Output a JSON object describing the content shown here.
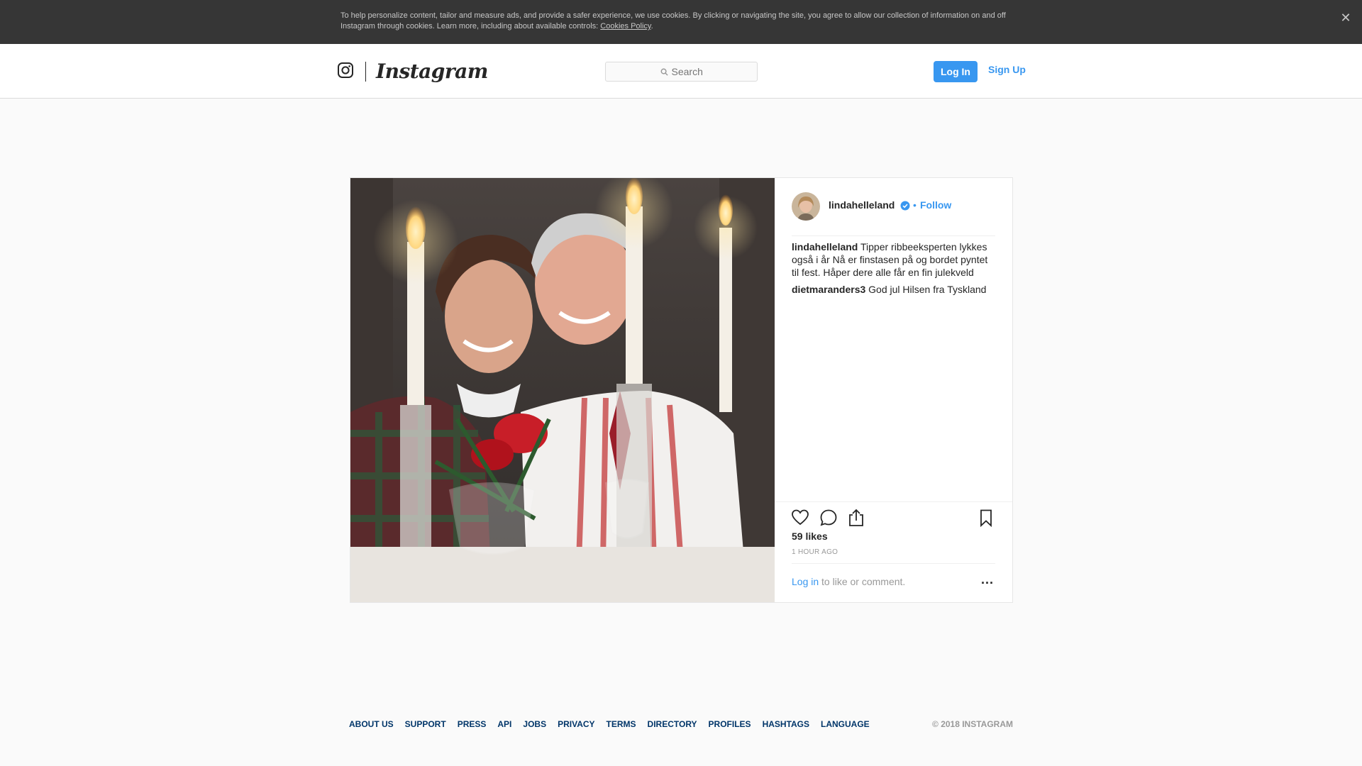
{
  "cookie_banner": {
    "text": "To help personalize content, tailor and measure ads, and provide a safer experience, we use cookies. By clicking or navigating the site, you agree to allow our collection of information on and off Instagram through cookies. Learn more, including about available controls: ",
    "link_text": "Cookies Policy",
    "trailing": ".",
    "close_icon": "close-icon"
  },
  "nav": {
    "logo_icon": "instagram-glyph-icon",
    "wordmark": "Instagram",
    "search_placeholder": "Search",
    "login_label": "Log In",
    "signup_label": "Sign Up"
  },
  "post": {
    "username": "lindahelleland",
    "verified": true,
    "separator": "•",
    "follow_label": "Follow",
    "comments": [
      {
        "user": "lindahelleland",
        "text": "Tipper ribbeeksperten lykkes også i år Nå er finstasen på og bordet pyntet til fest. Håper dere alle får en fin julekveld "
      },
      {
        "user": "dietmaranders3",
        "text": "God jul  Hilsen fra Tyskland  "
      }
    ],
    "likes": "59 likes",
    "time_ago": "1 HOUR AGO",
    "login_prompt_link": "Log in",
    "login_prompt_text": " to like or comment.",
    "more_label": "..."
  },
  "footer": {
    "links": [
      "ABOUT US",
      "SUPPORT",
      "PRESS",
      "API",
      "JOBS",
      "PRIVACY",
      "TERMS",
      "DIRECTORY",
      "PROFILES",
      "HASHTAGS",
      "LANGUAGE"
    ],
    "copyright": "© 2018 INSTAGRAM"
  },
  "colors": {
    "accent": "#3897f0",
    "banner_bg": "#363636",
    "footer_link": "#003569"
  }
}
